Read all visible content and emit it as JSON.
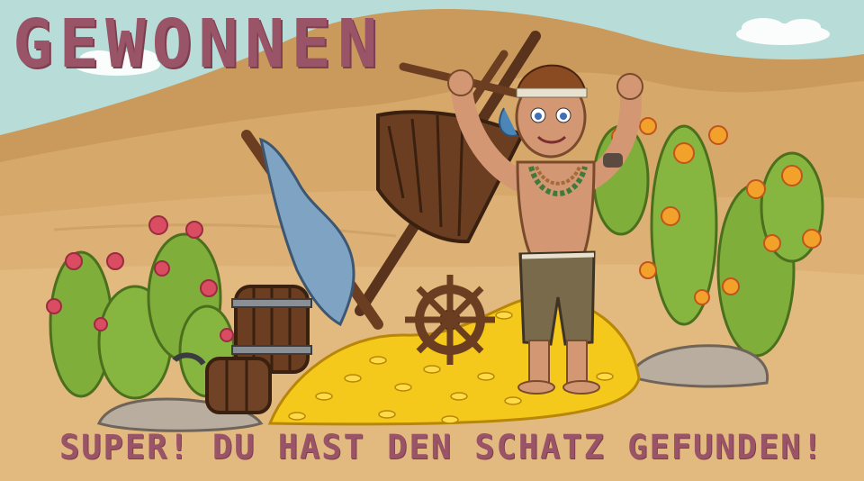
{
  "screen": {
    "title": "GEWONNEN",
    "message": "SUPER! DU HAST DEN SCHATZ GEFUNDEN!"
  },
  "colors": {
    "sky": "#b8ddd8",
    "dune_far": "#c99a5c",
    "dune_mid": "#d7ab6e",
    "sand_front": "#e0b77c",
    "text": "#9a5468",
    "gold": "#f5c81c",
    "wood": "#6b3e22",
    "cactus": "#7fae3a"
  },
  "icons": [
    "cloud-icon",
    "shipwreck-mast-icon",
    "barrel-icon",
    "ship-wheel-icon",
    "gold-coins-icon",
    "cactus-icon",
    "rock-icon",
    "pirate-boy-icon"
  ]
}
